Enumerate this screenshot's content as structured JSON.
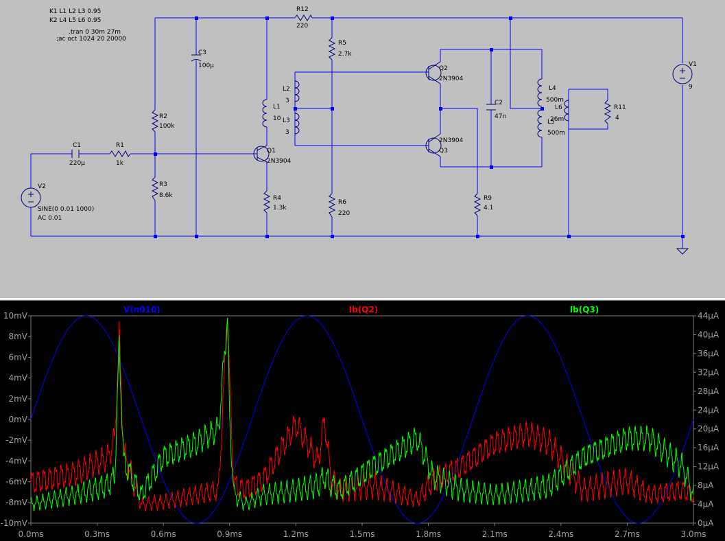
{
  "schematic": {
    "directives": [
      "K1 L1 L2 L3 0.95",
      "K2 L4 L5 L6 0.95",
      ".tran 0 30m 27m",
      ";ac oct 1024 20 20000"
    ],
    "components": {
      "C1": {
        "name": "C1",
        "value": "220µ"
      },
      "R1": {
        "name": "R1",
        "value": "1k"
      },
      "R2": {
        "name": "R2",
        "value": "100k"
      },
      "R3": {
        "name": "R3",
        "value": "8.6k"
      },
      "C3": {
        "name": "C3",
        "value": "100µ"
      },
      "L1": {
        "name": "L1",
        "value": "10"
      },
      "Q1": {
        "name": "Q1",
        "value": "2N3904"
      },
      "R4": {
        "name": "R4",
        "value": "1.3k"
      },
      "R12": {
        "name": "R12",
        "value": "220"
      },
      "R5": {
        "name": "R5",
        "value": "2.7k"
      },
      "L2": {
        "name": "L2",
        "value": "3"
      },
      "L3": {
        "name": "L3",
        "value": "3"
      },
      "R6": {
        "name": "R6",
        "value": "220"
      },
      "Q2": {
        "name": "Q2",
        "value": "2N3904"
      },
      "Q3": {
        "name": "Q3",
        "value": "2N3904"
      },
      "C2": {
        "name": "C2",
        "value": "47n"
      },
      "R9": {
        "name": "R9",
        "value": "4.1"
      },
      "L4": {
        "name": "L4",
        "value": "500m"
      },
      "L5": {
        "name": "L5",
        "value": "500m"
      },
      "L6": {
        "name": "L6",
        "value": "26m"
      },
      "R11": {
        "name": "R11",
        "value": "4"
      },
      "V1": {
        "name": "V1",
        "value": "9"
      },
      "V2": {
        "name": "V2",
        "value": "SINE(0 0.01 1000)",
        "value2": "AC 0.01"
      }
    }
  },
  "chart_data": {
    "type": "line",
    "series": [
      {
        "name": "V(n010)",
        "color": "#0000ff",
        "axis": "left",
        "shape": "sine",
        "amplitude_mV": 10,
        "offset_mV": 0,
        "frequency_kHz": 1,
        "phase": "starts at 0mV rising at 0.0ms"
      },
      {
        "name": "Ib(Q2)",
        "color": "#ff0000",
        "axis": "right",
        "x": [
          0.0,
          0.2,
          0.35,
          0.38,
          0.4,
          0.42,
          0.5,
          0.6,
          0.75,
          0.85,
          0.89,
          0.9,
          0.92,
          0.97,
          1.05,
          1.2,
          1.3,
          1.33,
          1.36,
          1.4,
          1.55,
          1.75,
          1.82,
          1.95,
          2.1,
          2.25,
          2.35,
          2.5,
          2.7,
          2.8,
          2.95,
          3.0
        ],
        "values": [
          8.5,
          10.5,
          14,
          18,
          40,
          15,
          4,
          4.5,
          6,
          7,
          44,
          30,
          8,
          7,
          9,
          21,
          13,
          22,
          9,
          7,
          8,
          5,
          9,
          12,
          17,
          19,
          17,
          7,
          9,
          6,
          7,
          6
        ]
      },
      {
        "name": "Ib(Q3)",
        "color": "#00ff00",
        "axis": "right",
        "x": [
          0.0,
          0.2,
          0.35,
          0.38,
          0.4,
          0.42,
          0.5,
          0.6,
          0.75,
          0.85,
          0.89,
          0.9,
          0.92,
          0.97,
          1.05,
          1.2,
          1.3,
          1.33,
          1.36,
          1.4,
          1.55,
          1.75,
          1.82,
          1.95,
          2.1,
          2.25,
          2.35,
          2.5,
          2.7,
          2.8,
          2.95,
          3.0
        ],
        "values": [
          4,
          6,
          8,
          10,
          38,
          13,
          6,
          14,
          17,
          20,
          44,
          22,
          6,
          4,
          6,
          7,
          8,
          10,
          8,
          7,
          12,
          18,
          10,
          7,
          6,
          7,
          8,
          14,
          18,
          18,
          12,
          6
        ]
      }
    ],
    "x_ticks": [
      "0.0ms",
      "0.3ms",
      "0.6ms",
      "0.9ms",
      "1.2ms",
      "1.5ms",
      "1.8ms",
      "2.1ms",
      "2.4ms",
      "2.7ms",
      "3.0ms"
    ],
    "y_left_ticks": [
      "10mV",
      "8mV",
      "6mV",
      "4mV",
      "2mV",
      "0mV",
      "-2mV",
      "-4mV",
      "-6mV",
      "-8mV",
      "-10mV"
    ],
    "y_right_ticks": [
      "44µA",
      "40µA",
      "36µA",
      "32µA",
      "28µA",
      "24µA",
      "20µA",
      "16µA",
      "12µA",
      "8µA",
      "4µA",
      "0µA"
    ],
    "xlim": [
      0,
      3.0
    ],
    "ylim_left": [
      -10,
      10
    ],
    "ylim_right": [
      0,
      44
    ],
    "grid": false,
    "legend": "top"
  }
}
